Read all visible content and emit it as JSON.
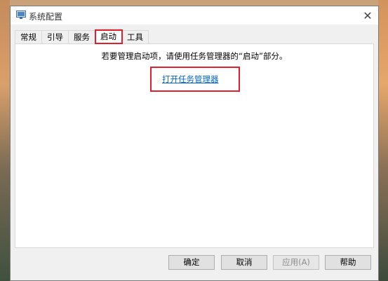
{
  "window": {
    "title": "系统配置",
    "close_glyph": "✕"
  },
  "tabs": [
    {
      "label": "常规",
      "active": false
    },
    {
      "label": "引导",
      "active": false
    },
    {
      "label": "服务",
      "active": false
    },
    {
      "label": "启动",
      "active": true
    },
    {
      "label": "工具",
      "active": false
    }
  ],
  "startup": {
    "message": "若要管理启动项，请使用任务管理器的“启动”部分。",
    "link_label": "打开任务管理器"
  },
  "buttons": {
    "ok": "确定",
    "cancel": "取消",
    "apply": "应用(A)",
    "help": "帮助"
  },
  "colors": {
    "highlight": "#e0202a",
    "link": "#0066cc"
  }
}
